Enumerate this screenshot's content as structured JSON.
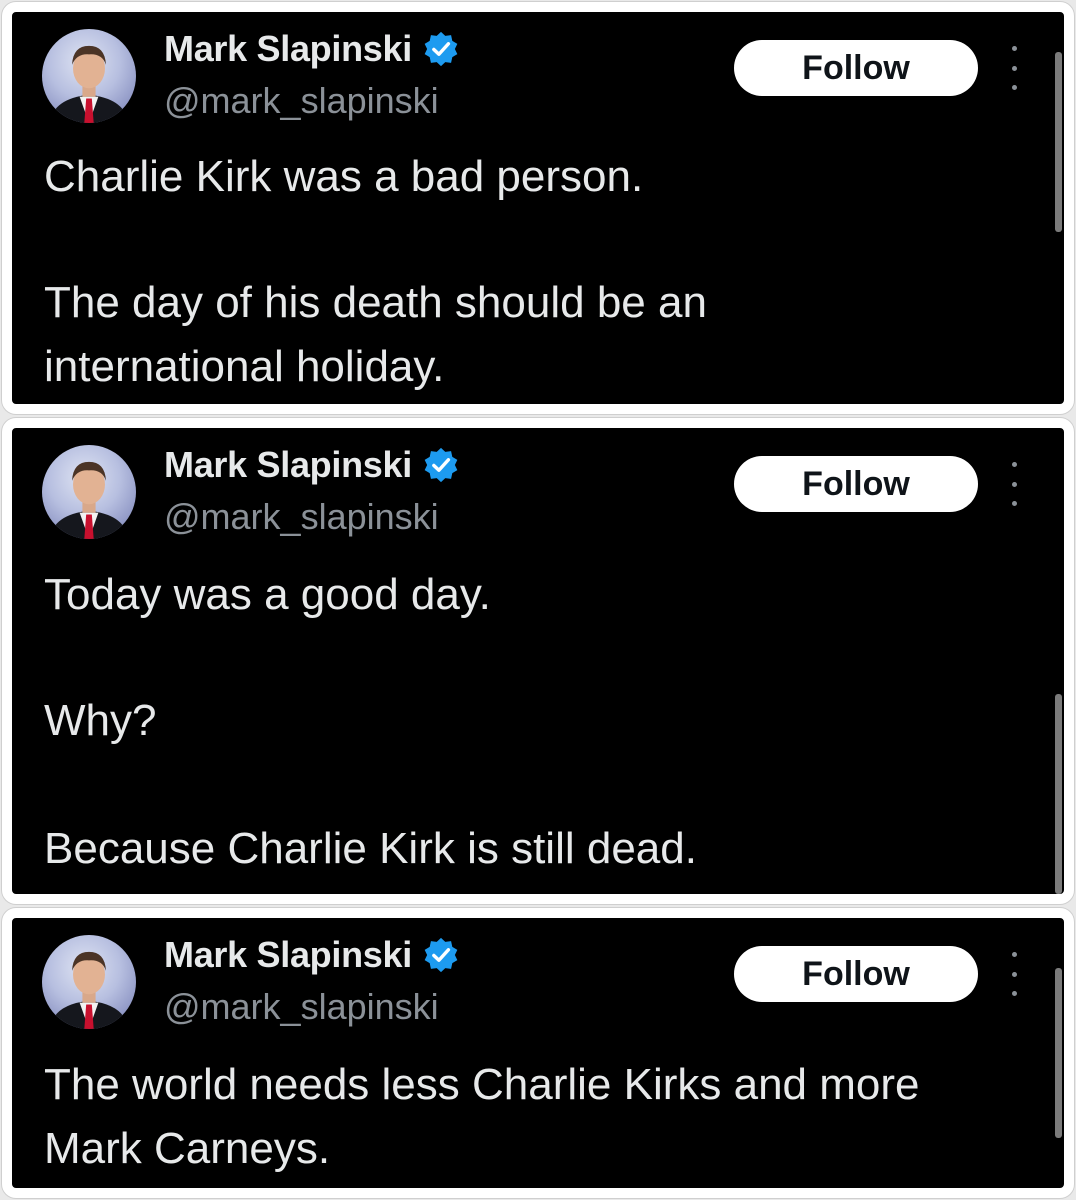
{
  "tweets": [
    {
      "author_name": "Mark Slapinski",
      "handle": "@mark_slapinski",
      "follow_label": "Follow",
      "lines": [
        "Charlie Kirk was a bad person.",
        "The day of his death should be an",
        "international holiday."
      ]
    },
    {
      "author_name": "Mark Slapinski",
      "handle": "@mark_slapinski",
      "follow_label": "Follow",
      "lines": [
        "Today was a good day.",
        "Why?",
        "Because Charlie Kirk is still dead."
      ]
    },
    {
      "author_name": "Mark Slapinski",
      "handle": "@mark_slapinski",
      "follow_label": "Follow",
      "lines": [
        "The world needs less Charlie Kirks and more",
        "Mark Carneys."
      ]
    }
  ],
  "icons": {
    "verified": "verified-badge-icon",
    "more": "more-options-icon",
    "avatar": "profile-photo"
  },
  "colors": {
    "background": "#000000",
    "text": "#e7e9ea",
    "muted": "#8b9198",
    "verified": "#1d9bf0",
    "follow_bg": "#ffffff"
  }
}
